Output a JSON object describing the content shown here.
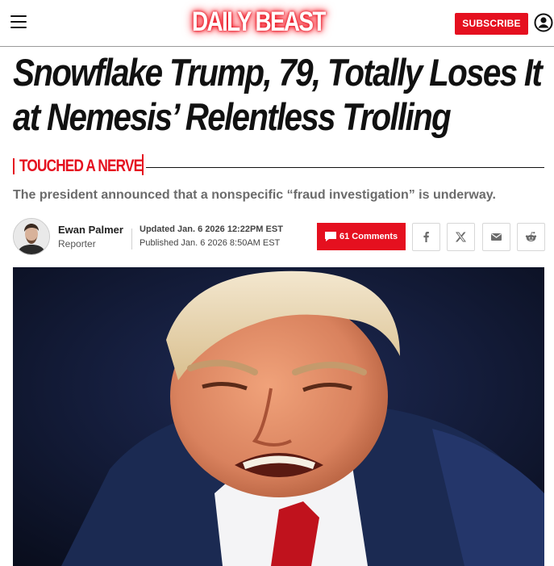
{
  "header": {
    "logo": "DAILY BEAST",
    "subscribe_label": "SUBSCRIBE"
  },
  "article": {
    "headline": "Snowflake Trump, 79, Totally Loses It at Nemesis’ Relentless Trolling",
    "kicker": "TOUCHED A NERVE",
    "dek": "The president announced that a nonspecific “fraud investigation” is underway.",
    "author": {
      "name": "Ewan Palmer",
      "role": "Reporter"
    },
    "updated": "Updated Jan. 6 2026 12:22PM EST",
    "published": "Published Jan. 6 2026 8:50AM EST",
    "comments_label": "61 Comments"
  },
  "share": {
    "icons": [
      "facebook-icon",
      "x-icon",
      "email-icon",
      "reddit-icon"
    ]
  },
  "colors": {
    "brand_red": "#e5101f",
    "hero_background": "#0d1326"
  }
}
